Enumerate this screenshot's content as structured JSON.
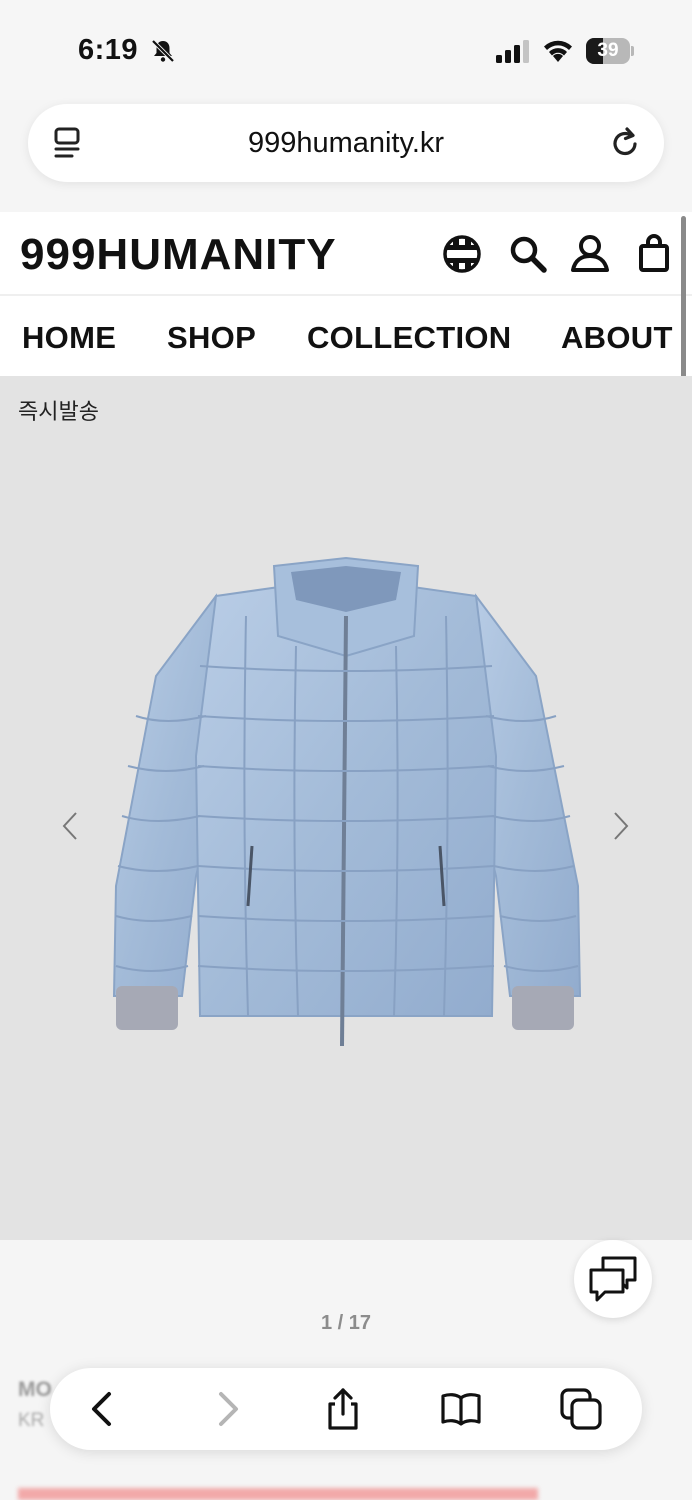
{
  "status": {
    "time": "6:19",
    "battery": "39",
    "battery_level": 0.39
  },
  "browser": {
    "url": "999humanity.kr"
  },
  "site": {
    "logo": "999HUMANITY",
    "nav": [
      "HOME",
      "SHOP",
      "COLLECTION",
      "ABOUT"
    ]
  },
  "product": {
    "badge": "즉시발송",
    "pager": "1 / 17",
    "title_peek": "MO",
    "sub_peek": "KR"
  },
  "icons": {
    "header": [
      "globe-icon",
      "search-icon",
      "account-icon",
      "cart-icon"
    ],
    "toolbar": [
      "back-icon",
      "forward-icon",
      "share-icon",
      "bookmarks-icon",
      "tabs-icon"
    ]
  },
  "colors": {
    "accent_red": "#e56464",
    "gallery_bg": "#e3e3e3",
    "jacket_blue": "#a9c0dc"
  }
}
